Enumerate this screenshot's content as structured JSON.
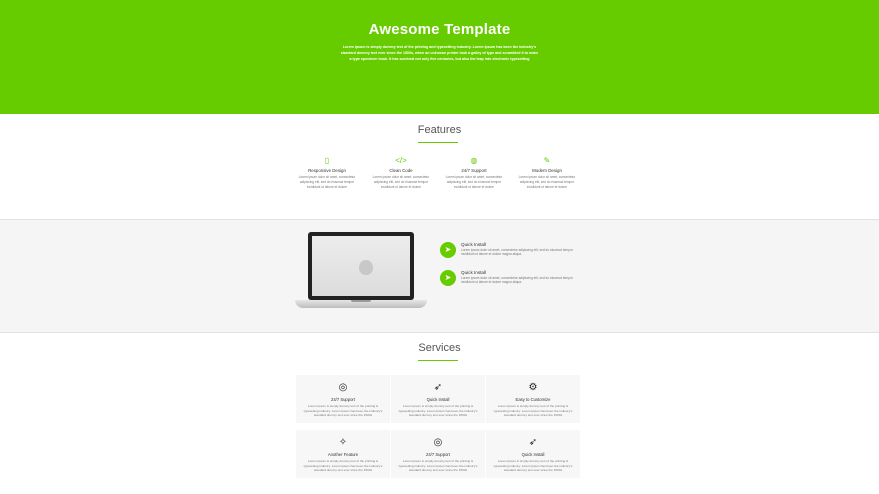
{
  "hero": {
    "title": "Awesome Template",
    "text": "Lorem Ipsum is simply dummy text of the printing and typesetting industry. Lorem Ipsum has been the industry's standard dummy text ever since the 1500s, when an unknown printer took a galley of type and scrambled it to make a type specimen book. It has survived not only five centuries, but also the leap into electronic typesetting"
  },
  "accent_color": "#66cc00",
  "features": {
    "title": "Features",
    "items": [
      {
        "icon": "mobile-icon",
        "glyph": "▯",
        "title": "Responsive Design",
        "text": "Lorem ipsum dolor sit amet, consectetur adipiscing elit, sed do eiusmod tempor incididunt ut labore et dolore"
      },
      {
        "icon": "code-icon",
        "glyph": "</>",
        "title": "Clean Code",
        "text": "Lorem ipsum dolor sit amet, consectetur adipiscing elit, sed do eiusmod tempor incididunt ut labore et dolore"
      },
      {
        "icon": "support-icon",
        "glyph": "◍",
        "title": "24/7 Support",
        "text": "Lorem ipsum dolor sit amet, consectetur adipiscing elit, sed do eiusmod tempor incididunt ut labore et dolore"
      },
      {
        "icon": "pencil-icon",
        "glyph": "✎",
        "title": "Modern Design",
        "text": "Lorem ipsum dolor sit amet, consectetur adipiscing elit, sed do eiusmod tempor incididunt ut labore et dolore"
      }
    ]
  },
  "highlights": [
    {
      "icon": "rocket-icon",
      "glyph": "➤",
      "title": "Quick Install",
      "text": "Lorem ipsum dolor sit amet, consectetur adipiscing elit, sed do eiusmod tempor incididunt ut labore et dolore magna aliqua."
    },
    {
      "icon": "rocket-icon",
      "glyph": "➤",
      "title": "Quick Install",
      "text": "Lorem ipsum dolor sit amet, consectetur adipiscing elit, sed do eiusmod tempor incididunt ut labore et dolore magna aliqua."
    }
  ],
  "services": {
    "title": "Services",
    "items": [
      {
        "icon": "support-icon",
        "glyph": "◎",
        "title": "24/7 Support",
        "text": "Lorem Ipsum is simply dummy text of the printing & typesetting industry. Lorem Ipsum has been the industry's standard dummy text ever since the 1500s"
      },
      {
        "icon": "rocket-icon",
        "glyph": "➶",
        "title": "Quick Install",
        "text": "Lorem Ipsum is simply dummy text of the printing & typesetting industry. Lorem Ipsum has been the industry's standard dummy text ever since the 1500s"
      },
      {
        "icon": "gears-icon",
        "glyph": "⚙",
        "title": "Easy to Customize",
        "text": "Lorem Ipsum is simply dummy text of the printing & typesetting industry. Lorem Ipsum has been the industry's standard dummy text ever since the 1500s"
      },
      {
        "icon": "magic-wand-icon",
        "glyph": "✧",
        "title": "Another Feature",
        "text": "Lorem Ipsum is simply dummy text of the printing & typesetting industry. Lorem Ipsum has been the industry's standard dummy text ever since the 1500s"
      },
      {
        "icon": "support-icon",
        "glyph": "◎",
        "title": "24/7 Support",
        "text": "Lorem Ipsum is simply dummy text of the printing & typesetting industry. Lorem Ipsum has been the industry's standard dummy text ever since the 1500s"
      },
      {
        "icon": "rocket-icon",
        "glyph": "➶",
        "title": "Quick Install",
        "text": "Lorem Ipsum is simply dummy text of the printing & typesetting industry. Lorem Ipsum has been the industry's standard dummy text ever since the 1500s"
      }
    ]
  }
}
